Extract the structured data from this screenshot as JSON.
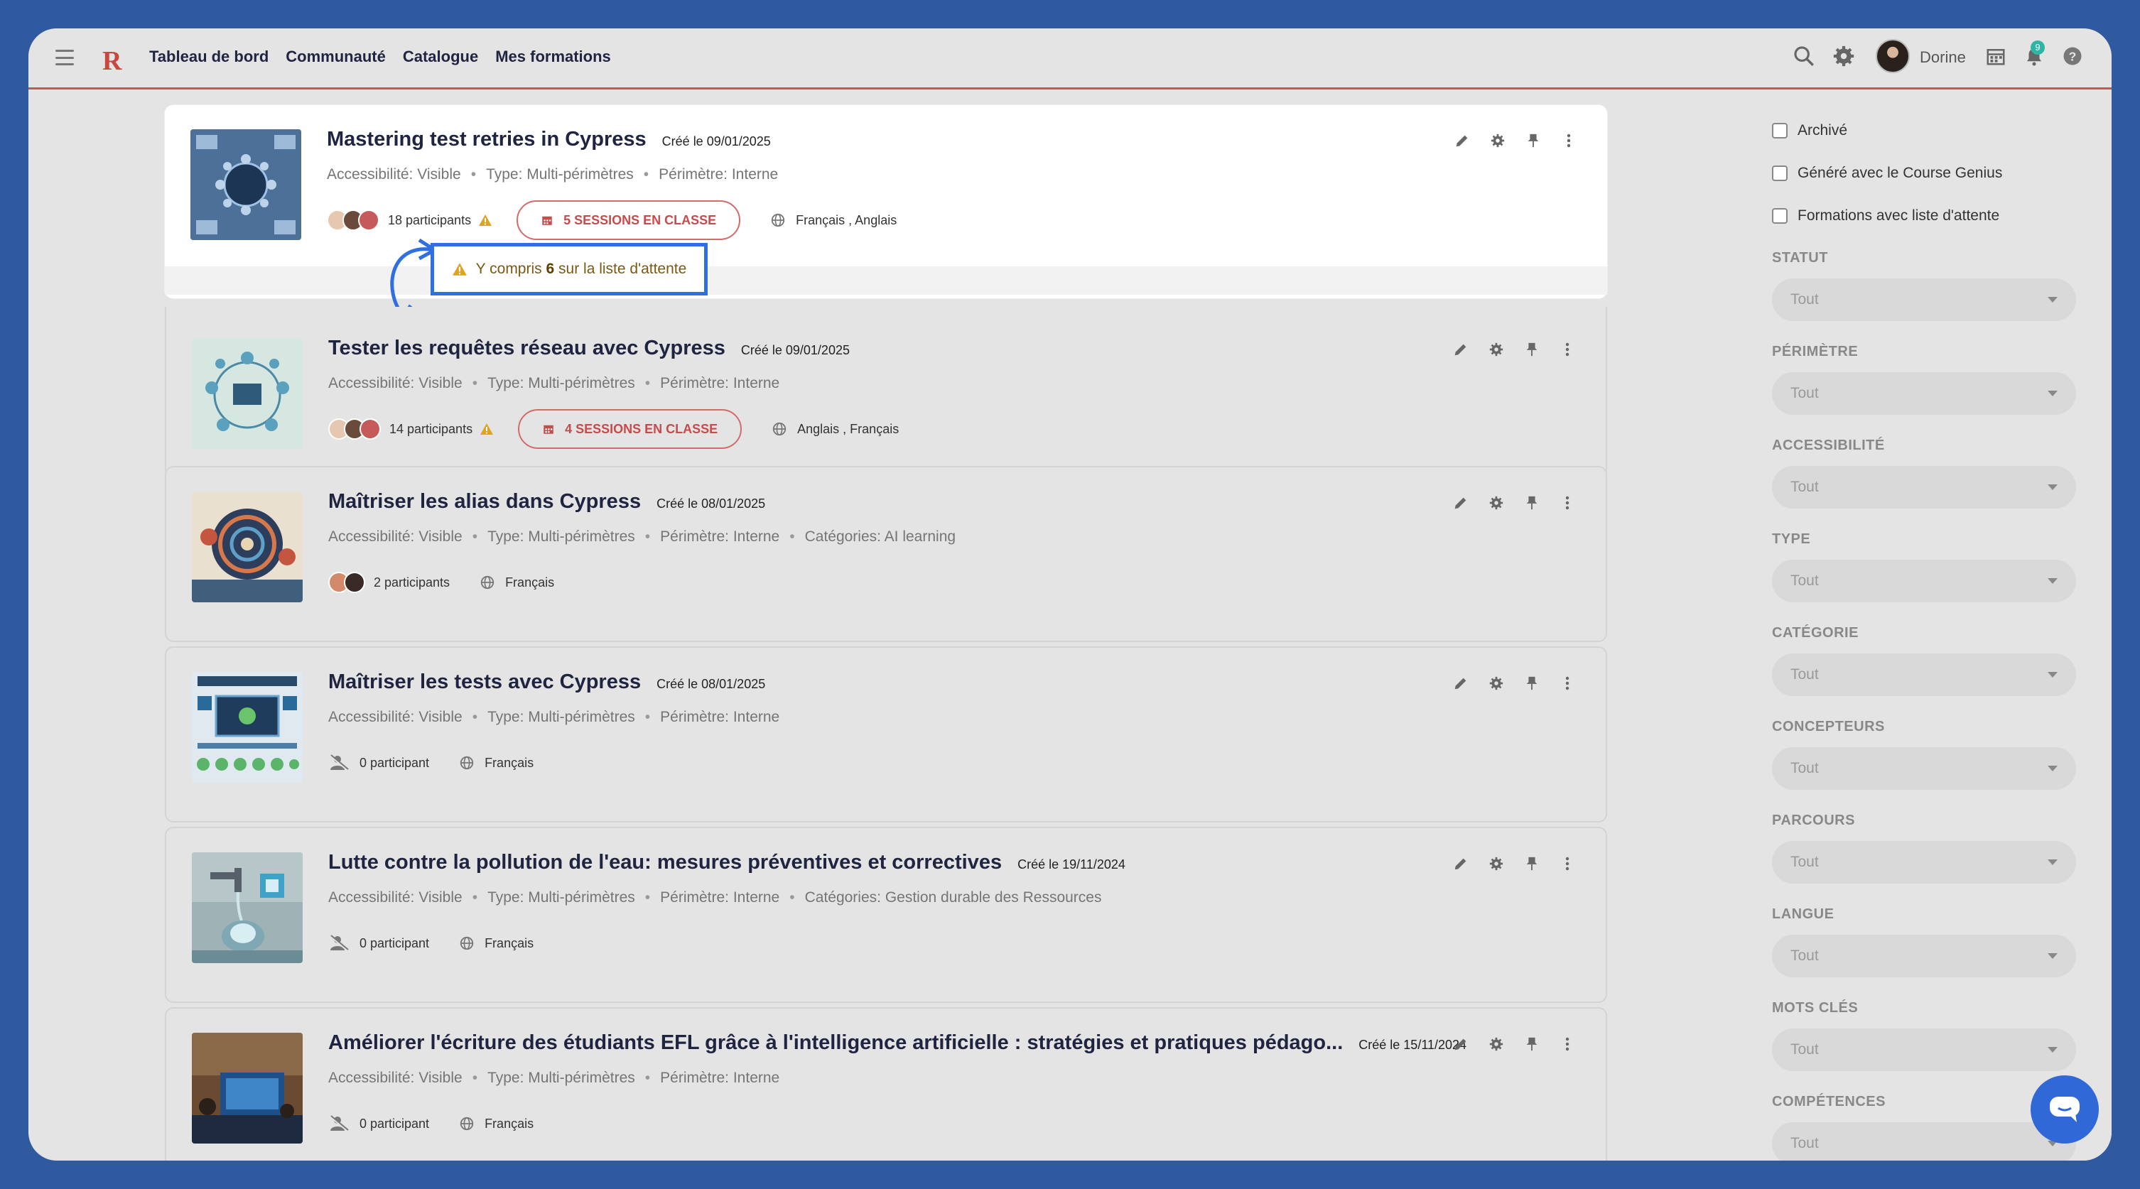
{
  "nav": {
    "items": [
      "Tableau de bord",
      "Communauté",
      "Catalogue",
      "Mes formations"
    ],
    "user_name": "Dorine",
    "notification_count": "9"
  },
  "courses": [
    {
      "title": "Mastering test retries in Cypress",
      "date": "Créé le 09/01/2025",
      "meta": [
        "Accessibilité: Visible",
        "Type: Multi-périmètres",
        "Périmètre: Interne"
      ],
      "participants": "18 participants",
      "sessions": "5 SESSIONS EN CLASSE",
      "languages": "Français , Anglais"
    },
    {
      "title": "Tester les requêtes réseau avec Cypress",
      "date": "Créé le 09/01/2025",
      "meta": [
        "Accessibilité: Visible",
        "Type: Multi-périmètres",
        "Périmètre: Interne"
      ],
      "participants": "14 participants",
      "sessions": "4 SESSIONS EN CLASSE",
      "languages": "Anglais , Français"
    },
    {
      "title": "Maîtriser les alias dans Cypress",
      "date": "Créé le 08/01/2025",
      "meta": [
        "Accessibilité: Visible",
        "Type: Multi-périmètres",
        "Périmètre: Interne",
        "Catégories: AI learning"
      ],
      "participants": "2 participants",
      "languages": "Français"
    },
    {
      "title": "Maîtriser les tests avec Cypress",
      "date": "Créé le 08/01/2025",
      "meta": [
        "Accessibilité: Visible",
        "Type: Multi-périmètres",
        "Périmètre: Interne"
      ],
      "participants": "0 participant",
      "languages": "Français"
    },
    {
      "title": "Lutte contre la pollution de l'eau: mesures préventives et correctives",
      "date": "Créé le 19/11/2024",
      "meta": [
        "Accessibilité: Visible",
        "Type: Multi-périmètres",
        "Périmètre: Interne",
        "Catégories: Gestion durable des Ressources"
      ],
      "participants": "0 participant",
      "languages": "Français"
    },
    {
      "title": "Améliorer l'écriture des étudiants EFL grâce à l'intelligence artificielle : stratégies et pratiques pédago...",
      "date": "Créé le 15/11/2024",
      "meta": [
        "Accessibilité: Visible",
        "Type: Multi-périmètres",
        "Périmètre: Interne"
      ],
      "participants": "0 participant",
      "languages": "Français"
    }
  ],
  "tooltip": {
    "prefix": "Y compris",
    "count": "6",
    "suffix": "sur la liste d'attente"
  },
  "filters": {
    "checkboxes": [
      "Archivé",
      "Généré avec le Course Genius",
      "Formations avec liste d'attente"
    ],
    "selects": [
      {
        "label": "STATUT",
        "value": "Tout"
      },
      {
        "label": "PÉRIMÈTRE",
        "value": "Tout"
      },
      {
        "label": "ACCESSIBILITÉ",
        "value": "Tout"
      },
      {
        "label": "TYPE",
        "value": "Tout"
      },
      {
        "label": "CATÉGORIE",
        "value": "Tout"
      },
      {
        "label": "CONCEPTEURS",
        "value": "Tout"
      },
      {
        "label": "PARCOURS",
        "value": "Tout"
      },
      {
        "label": "LANGUE",
        "value": "Tout"
      },
      {
        "label": "MOTS CLÉS",
        "value": "Tout"
      },
      {
        "label": "COMPÉTENCES",
        "value": "Tout"
      }
    ]
  },
  "colors": {
    "accent": "#c35656",
    "tooltip_border": "#2f6fe0",
    "chat_button": "#3068d8"
  }
}
